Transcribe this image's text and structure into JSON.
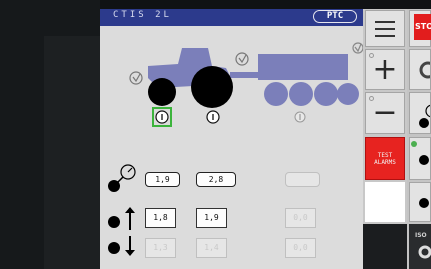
{
  "header": {
    "title": "CTIS 2L",
    "ptc_label": "PTC"
  },
  "colors": {
    "title_bar": "#2c3a8c",
    "vehicle": "#7b7fba",
    "test_alarm": "#e72320",
    "selected_green": "#3cb43c"
  },
  "vehicle": {
    "axle_labels": [
      "I",
      "I",
      "I"
    ],
    "selected_axle": 0
  },
  "pressure": {
    "current_label": "pressure-gauge-icon",
    "current_values": [
      "1,9",
      "2,8",
      ""
    ],
    "inflate_values": [
      "1,8",
      "1,9",
      "0,0"
    ],
    "deflate_values": [
      "1,3",
      "1,4",
      "0,0"
    ]
  },
  "right_panel": {
    "menu_icon": "menu-icon",
    "plus": "+",
    "minus": "−",
    "test_alarm_label": "TEST\nALARMS"
  },
  "far_right": {
    "stop_label": "STO",
    "iso_label": "ISO"
  }
}
